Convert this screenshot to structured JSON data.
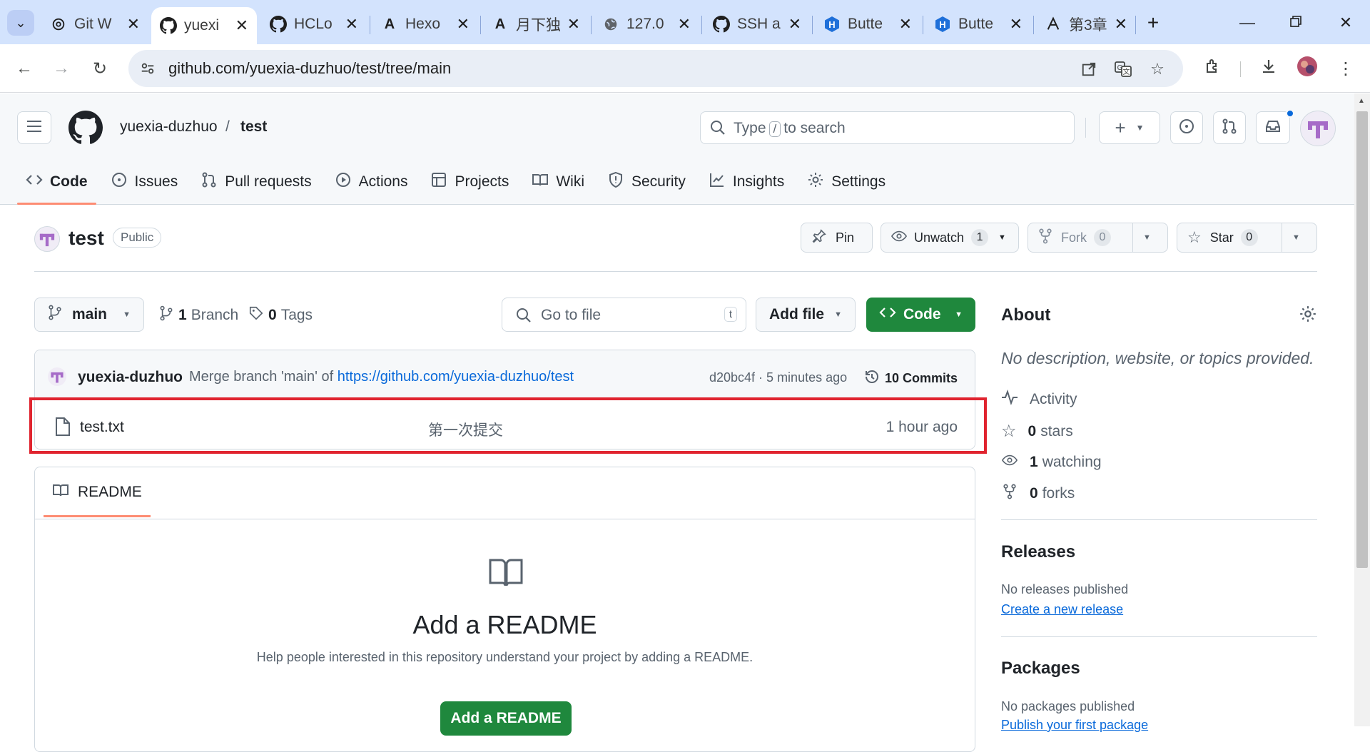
{
  "browser": {
    "tabs": [
      {
        "label": "Git W",
        "favicon": "openai-icon",
        "active": false
      },
      {
        "label": "yuexi",
        "favicon": "github-icon",
        "active": true
      },
      {
        "label": "HCLo",
        "favicon": "github-icon",
        "active": false
      },
      {
        "label": "Hexo",
        "favicon": "letter-a-icon",
        "active": false
      },
      {
        "label": "月下独",
        "favicon": "letter-a-icon",
        "active": false
      },
      {
        "label": "127.0",
        "favicon": "globe-icon",
        "active": false
      },
      {
        "label": "SSH a",
        "favicon": "github-icon",
        "active": false
      },
      {
        "label": "Butte",
        "favicon": "hexagon-h-icon",
        "active": false
      },
      {
        "label": "Butte",
        "favicon": "hexagon-h-icon",
        "active": false
      },
      {
        "label": "第3章",
        "favicon": "compass-icon",
        "active": false
      }
    ],
    "url": "github.com/yuexia-duzhuo/test/tree/main"
  },
  "header": {
    "owner": "yuexia-duzhuo",
    "slash": "/",
    "repo": "test",
    "search": {
      "before": "Type",
      "key": "/",
      "after": "to search"
    }
  },
  "repo_nav": [
    {
      "label": "Code",
      "icon": "code-icon",
      "active": true
    },
    {
      "label": "Issues",
      "icon": "issue-icon"
    },
    {
      "label": "Pull requests",
      "icon": "pull-request-icon"
    },
    {
      "label": "Actions",
      "icon": "play-icon"
    },
    {
      "label": "Projects",
      "icon": "table-icon"
    },
    {
      "label": "Wiki",
      "icon": "book-icon"
    },
    {
      "label": "Security",
      "icon": "shield-icon"
    },
    {
      "label": "Insights",
      "icon": "graph-icon"
    },
    {
      "label": "Settings",
      "icon": "gear-icon"
    }
  ],
  "repo": {
    "name": "test",
    "visibility": "Public",
    "pin_label": "Pin",
    "unwatch_label": "Unwatch",
    "watch_count": "1",
    "fork_label": "Fork",
    "fork_count": "0",
    "star_label": "Star",
    "star_count": "0"
  },
  "browser_controls": {
    "branch": "main",
    "branch_count": "1",
    "branch_label": "Branch",
    "tag_count": "0",
    "tag_label": "Tags",
    "goto_placeholder": "Go to file",
    "goto_key": "t",
    "add_file_label": "Add file",
    "code_label": "Code"
  },
  "last_commit": {
    "author": "yuexia-duzhuo",
    "message": "Merge branch 'main' of",
    "link": "https://github.com/yuexia-duzhuo/test",
    "sha_time": "d20bc4f · 5 minutes ago",
    "commits_count": "10",
    "commits_label": "Commits"
  },
  "files": [
    {
      "name": "test.txt",
      "message": "第一次提交",
      "time": "1 hour ago"
    }
  ],
  "readme": {
    "tab_label": "README",
    "title": "Add a README",
    "description": "Help people interested in this repository understand your project by adding a README.",
    "button_label": "Add a README"
  },
  "sidebar": {
    "about_title": "About",
    "about_desc": "No description, website, or topics provided.",
    "activity_label": "Activity",
    "stars_count": "0",
    "stars_label": "stars",
    "watching_count": "1",
    "watching_label": "watching",
    "forks_count": "0",
    "forks_label": "forks",
    "releases_title": "Releases",
    "releases_none": "No releases published",
    "releases_link": "Create a new release",
    "packages_title": "Packages",
    "packages_none": "No packages published",
    "packages_link": "Publish your first package"
  },
  "colors": {
    "primary_green": "#1f883d",
    "link_blue": "#0969da",
    "highlight_red": "#e0242f",
    "nav_underline": "#fd8c73"
  }
}
